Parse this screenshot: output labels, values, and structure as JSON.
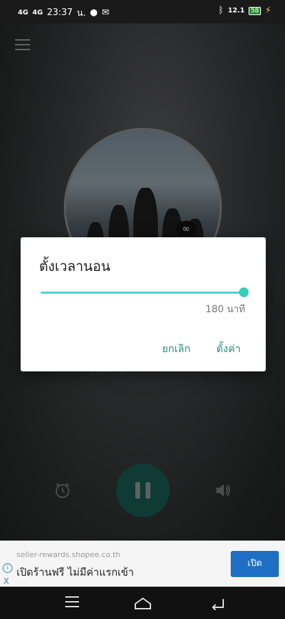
{
  "status": {
    "time": "23:37",
    "suffix": "น.",
    "signal_1": "4G",
    "signal_2": "4G",
    "data_speed": "12.1",
    "battery_level": "58"
  },
  "dialog": {
    "title": "ตั้งเวลานอน",
    "value_label": "180 นาที",
    "slider_fraction": 1.0,
    "cancel_label": "ยกเลิก",
    "ok_label": "ตั้งค่า"
  },
  "player": {
    "song_text": "Bo-dis ... ................",
    "accent": "#1a5a50"
  },
  "ad": {
    "url": "seller-rewards.shopee.co.th",
    "text": "เปิดร้านฟรี ไม่มีค่าแรกเข้า",
    "button": "เปิด",
    "close": "X"
  },
  "colors": {
    "slider": "#4ad3c5",
    "dialog_button": "#2b8f83"
  }
}
